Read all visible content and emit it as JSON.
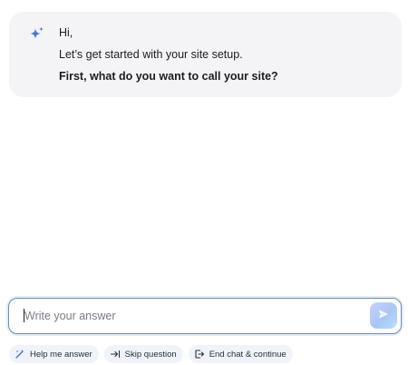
{
  "chat": {
    "greeting": "Hi,",
    "intro": "Let’s get started with your site setup.",
    "question": "First, what do you want to call your site?"
  },
  "composer": {
    "placeholder": "Write your answer",
    "value": ""
  },
  "actions": {
    "help_label": "Help me answer",
    "skip_label": "Skip question",
    "end_label": "End chat & continue"
  },
  "icons": {
    "ai": "sparkle-icon",
    "send": "send-arrow-icon",
    "help": "magic-wand-icon",
    "skip": "skip-arrow-icon",
    "end": "exit-icon"
  },
  "colors": {
    "accent": "#3b6fd4",
    "card_bg": "#f4f4f6",
    "input_border": "#6b8fb3",
    "chip_bg": "#f0f4fa"
  }
}
